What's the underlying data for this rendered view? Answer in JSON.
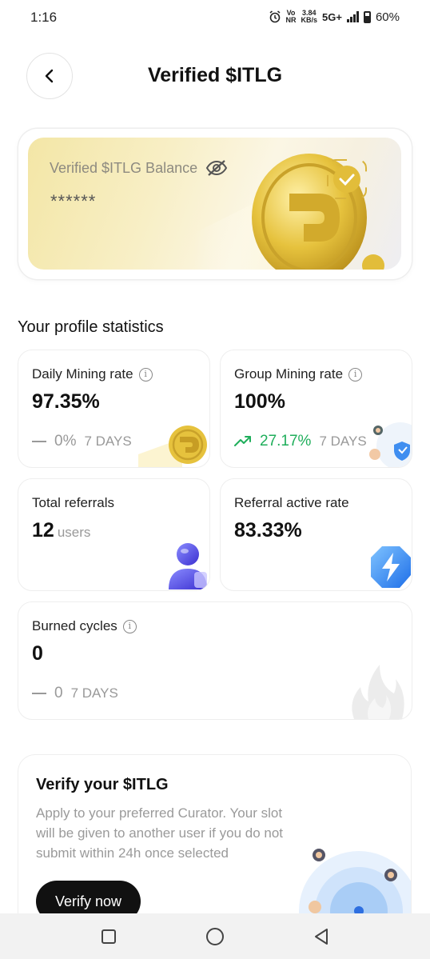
{
  "status_bar": {
    "time": "1:16",
    "net_top": "Vo",
    "net_bottom": "NR",
    "speed_top": "3.84",
    "speed_bottom": "KB/s",
    "network": "5G+",
    "battery": "60%"
  },
  "header": {
    "title": "Verified $ITLG",
    "back_icon": "chevron-left-icon"
  },
  "balance": {
    "label": "Verified $ITLG Balance",
    "value": "******",
    "toggle_icon": "eye-off-icon"
  },
  "stats_section": {
    "title": "Your profile statistics",
    "daily_mining": {
      "label": "Daily Mining rate",
      "value": "97.35%",
      "change": "0%",
      "period": "7 DAYS",
      "trend_icon": "dash-icon"
    },
    "group_mining": {
      "label": "Group Mining rate",
      "value": "100%",
      "change": "27.17%",
      "period": "7 DAYS",
      "trend_icon": "trend-up-icon"
    },
    "total_referrals": {
      "label": "Total referrals",
      "value": "12",
      "unit": "users"
    },
    "referral_active_rate": {
      "label": "Referral active rate",
      "value": "83.33%"
    },
    "burned_cycles": {
      "label": "Burned cycles",
      "value": "0",
      "change": "0",
      "period": "7 DAYS",
      "trend_icon": "dash-icon"
    }
  },
  "verify": {
    "title": "Verify your $ITLG",
    "description": "Apply to your preferred Curator. Your slot will be given to another user if you do not submit within 24h once selected",
    "button": "Verify now"
  },
  "colors": {
    "accent_green": "#1fae5b",
    "gold": "#e9c94a",
    "button_dark": "#111111"
  }
}
